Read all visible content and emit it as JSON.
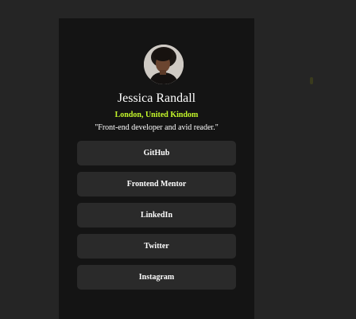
{
  "profile": {
    "name": "Jessica Randall",
    "location": "London, United Kindom",
    "bio": "\"Front-end developer and avid reader.\""
  },
  "links": [
    {
      "label": "GitHub"
    },
    {
      "label": "Frontend Mentor"
    },
    {
      "label": "LinkedIn"
    },
    {
      "label": "Twitter"
    },
    {
      "label": "Instagram"
    }
  ],
  "colors": {
    "page_background": "#252525",
    "card_background": "#141414",
    "button_background": "#2a2a2a",
    "accent": "#c4f82a",
    "text": "#ffffff"
  }
}
